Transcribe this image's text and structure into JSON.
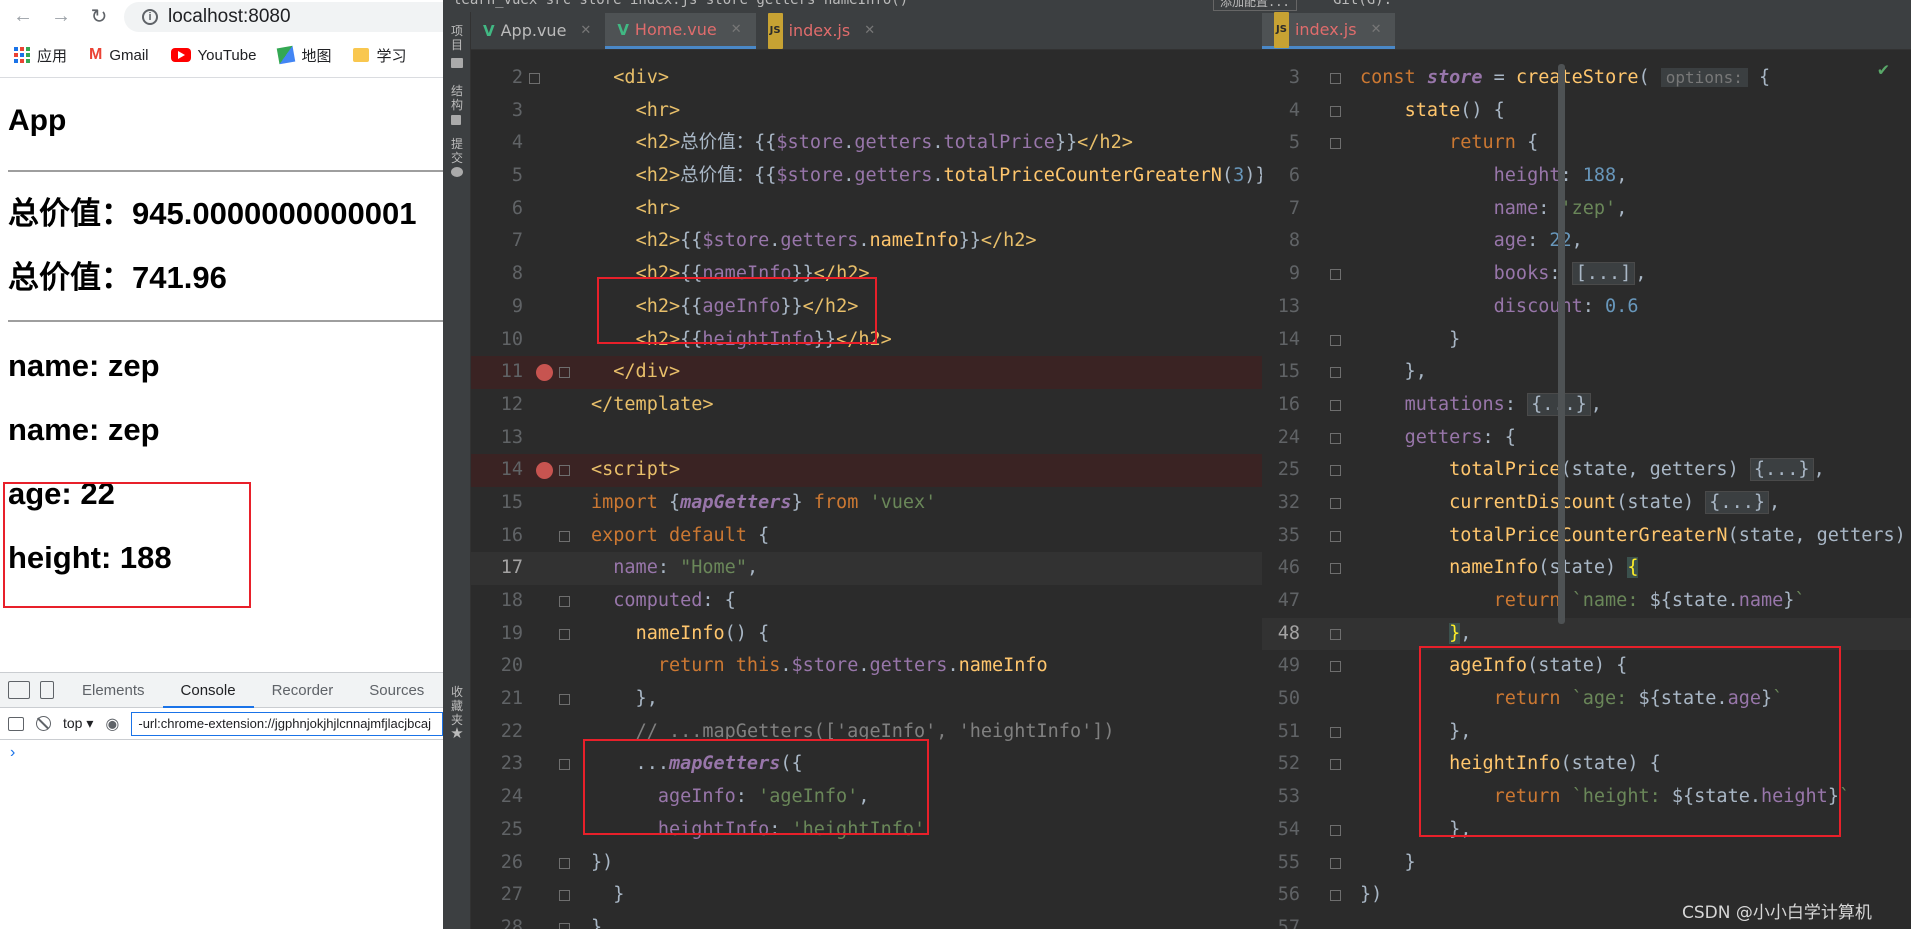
{
  "browser": {
    "url": "localhost:8080",
    "bookmarks": [
      {
        "label": "应用",
        "icon": "apps-icon"
      },
      {
        "label": "Gmail",
        "icon": "gmail-icon"
      },
      {
        "label": "YouTube",
        "icon": "youtube-icon"
      },
      {
        "label": "地图",
        "icon": "maps-icon"
      },
      {
        "label": "学习",
        "icon": "folder-icon"
      }
    ],
    "app": {
      "title": "App",
      "lines": [
        "总价值：945.0000000000001",
        "总价值：741.96",
        "name: zep",
        "name: zep",
        "age: 22",
        "height: 188"
      ]
    },
    "devtools": {
      "tabs": [
        "Elements",
        "Console",
        "Recorder",
        "Sources"
      ],
      "active_tab": "Console",
      "context": "top",
      "filter": "-url:chrome-extension://jgphnjokjhjlcnnajmfjlacjbcaj"
    }
  },
  "ide": {
    "top_text": "learn_vuex  src  store  index.js  store  getters  nameInfo()",
    "right_top_btn": "添加配置...",
    "git_label": "Git(G):",
    "left_strip": [
      "项目",
      "结构",
      "提交",
      "收藏夹"
    ],
    "pane1_tabs": [
      {
        "label": "App.vue",
        "type": "vue"
      },
      {
        "label": "Home.vue",
        "type": "vue",
        "active": true
      },
      {
        "label": "index.js",
        "type": "js"
      }
    ],
    "pane2_tabs": [
      {
        "label": "index.js",
        "type": "js",
        "active": true
      }
    ],
    "pane1_line_numbers": [
      "2",
      "3",
      "4",
      "5",
      "6",
      "7",
      "8",
      "9",
      "10",
      "11",
      "12",
      "13",
      "14",
      "15",
      "16",
      "17",
      "18",
      "19",
      "20",
      "21",
      "22",
      "23",
      "24",
      "25",
      "26",
      "27",
      "28"
    ],
    "pane2_line_numbers": [
      "3",
      "4",
      "5",
      "6",
      "7",
      "8",
      "9",
      "13",
      "14",
      "15",
      "16",
      "24",
      "25",
      "32",
      "35",
      "46",
      "47",
      "48",
      "49",
      "50",
      "51",
      "52",
      "53",
      "54",
      "55",
      "56",
      "57"
    ]
  },
  "colors": {
    "accent": "#4a88c7",
    "redbox": "#e8202a",
    "editor_bg": "#2b2b2b"
  },
  "watermark": "CSDN @小小白学计算机"
}
